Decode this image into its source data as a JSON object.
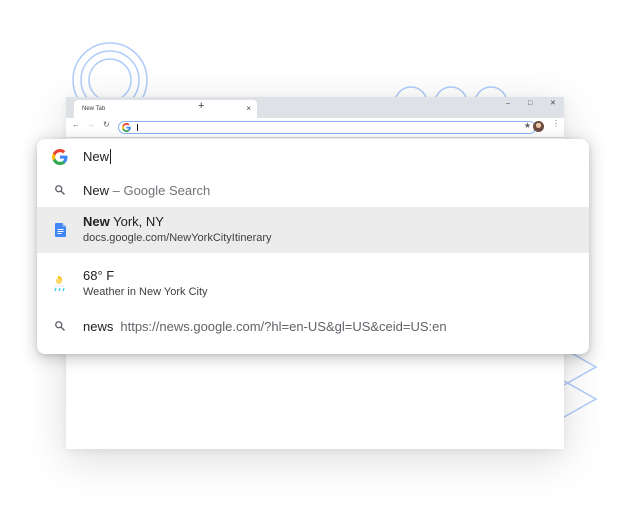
{
  "browser": {
    "tab_title": "New Tab",
    "tab_close": "×",
    "new_tab": "+",
    "window_controls": {
      "minimize": "–",
      "maximize": "□",
      "close": "✕"
    },
    "nav": {
      "back": "←",
      "forward": "→",
      "reload": "↻"
    },
    "omnibox_star": "★",
    "menu": "⋮"
  },
  "omnibox": {
    "input_value": "New"
  },
  "suggestions": [
    {
      "icon": "search-icon",
      "match": "New",
      "rest": "",
      "suffix": " – Google Search"
    },
    {
      "icon": "docs-icon",
      "match": "New",
      "rest": " York, NY",
      "secondary": "docs.google.com/NewYorkCityItinerary",
      "highlighted": true
    },
    {
      "icon": "weather-icon",
      "title": "68° F",
      "secondary": "Weather in New York City"
    },
    {
      "icon": "search-icon",
      "match": "news",
      "url": "https://news.google.com/?hl=en-US&gl=US&ceid=US:en"
    }
  ],
  "colors": {
    "accent": "#4285f4",
    "highlight_row": "#ececec",
    "decor_lines": "#aecbfa"
  }
}
